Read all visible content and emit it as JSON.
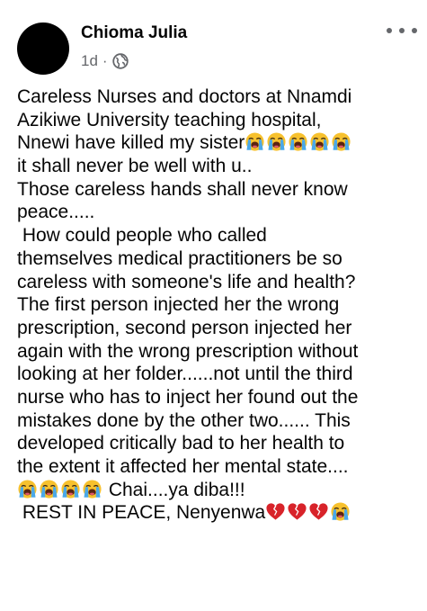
{
  "post": {
    "author": {
      "name": "Chioma Julia",
      "avatar_color": "#000000"
    },
    "time": "1d",
    "separator": "·",
    "privacy_icon": "globe-icon",
    "more_icon": "more-options-icon",
    "body": {
      "line1": "Careless Nurses and doctors at Nnamdi",
      "line2": "Azikiwe University teaching hospital,",
      "line3": "Nnewi have killed my sister",
      "line4": "it shall  never be well with u..",
      "line5": "Those careless hands shall never know",
      "line6": "peace.....",
      "line7": " How could people who called",
      "line8": "themselves medical practitioners be so",
      "line9": "careless with someone's life and health?",
      "line10": "The first person injected her the wrong",
      "line11": "prescription, second person injected her",
      "line12": "again with the wrong prescription without",
      "line13": "looking at her folder......not until the third",
      "line14": "nurse who has to inject her found out the",
      "line15": "mistakes done by the other two...... This",
      "line16": "developed critically bad to her health to",
      "line17": "the extent it  affected her mental state....",
      "line18": " Chai....ya diba!!!",
      "line19": " REST IN PEACE, Nenyenwa"
    },
    "emoji": {
      "crying": "loudly-crying-face-emoji",
      "broken_heart": "broken-heart-emoji"
    },
    "colors": {
      "text": "#050505",
      "secondary": "#65676b",
      "emoji_yellow": "#f7c12e",
      "tears": "#4aa8e8",
      "heart": "#d8232a"
    }
  }
}
